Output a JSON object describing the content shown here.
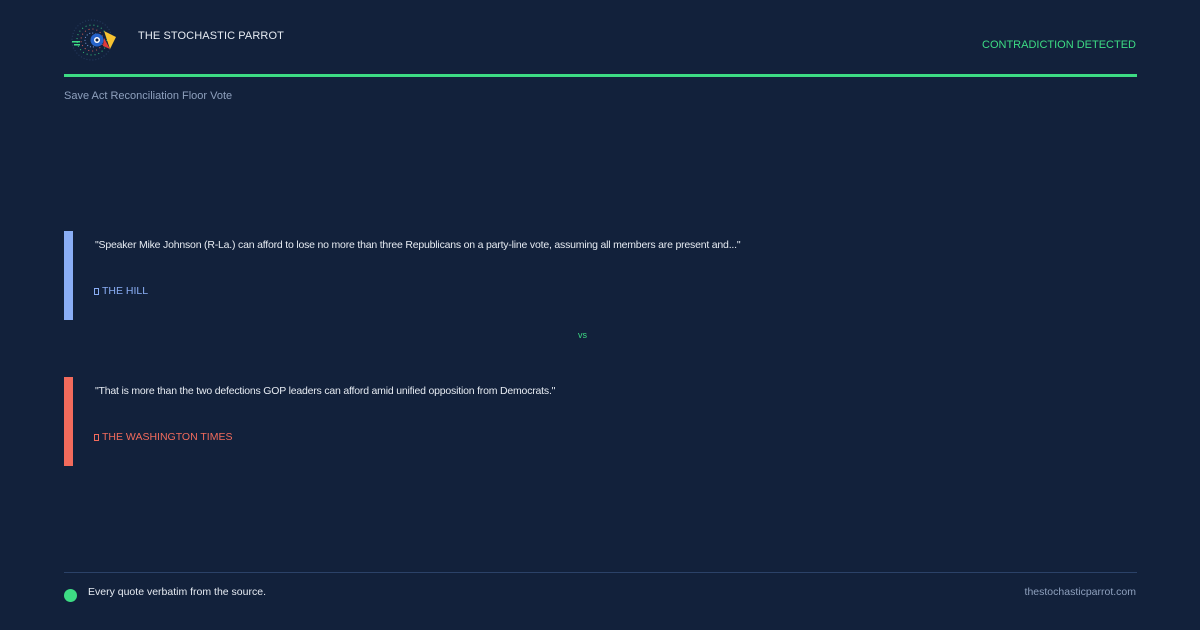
{
  "header": {
    "brand_name": "THE STOCHASTIC PARROT",
    "status": "CONTRADICTION DETECTED",
    "topic": "Save Act Reconciliation Floor Vote",
    "logo_icon": "parrot-logo-icon"
  },
  "quotes": [
    {
      "text": "\"Speaker Mike Johnson (R-La.) can afford to lose no more than three Republicans on a party-line vote, assuming all members are present and...\"",
      "source": "THE HILL",
      "color": "#8aaef5"
    },
    {
      "text": "\"That is more than the two defections GOP leaders can afford amid unified opposition from Democrats.\"",
      "source": "THE WASHINGTON TIMES",
      "color": "#f26b5c"
    }
  ],
  "separator": "vs",
  "footer": {
    "note": "Every quote verbatim from the source.",
    "url": "thestochasticparrot.com"
  },
  "colors": {
    "background": "#12213b",
    "accent": "#3ddc84",
    "source_a": "#8aaef5",
    "source_b": "#f26b5c"
  }
}
